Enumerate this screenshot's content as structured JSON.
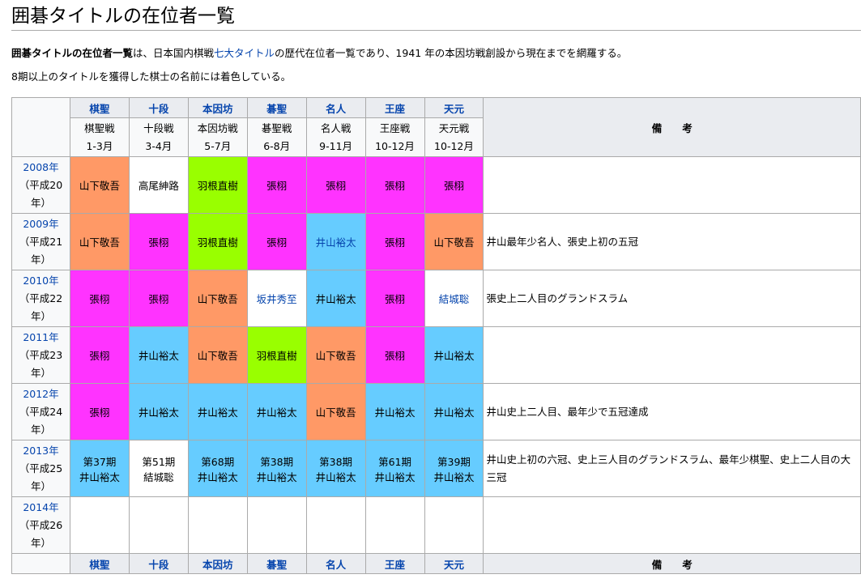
{
  "page": {
    "title": "囲碁タイトルの在位者一覧",
    "intro_bold": "囲碁タイトルの在位者一覧",
    "intro_text1": "は、日本国内棋戦",
    "intro_link": "七大タイトル",
    "intro_text2": "の歴代在位者一覧であり、1941 年の本因坊戦創設から現在までを網羅する。",
    "note": "8期以上のタイトルを獲得した棋士の名前には着色している。"
  },
  "table": {
    "titles": [
      {
        "name": "棋聖",
        "event": "棋聖戦",
        "months": "1-3月"
      },
      {
        "name": "十段",
        "event": "十段戦",
        "months": "3-4月"
      },
      {
        "name": "本因坊",
        "event": "本因坊戦",
        "months": "5-7月"
      },
      {
        "name": "碁聖",
        "event": "碁聖戦",
        "months": "6-8月"
      },
      {
        "name": "名人",
        "event": "名人戦",
        "months": "9-11月"
      },
      {
        "name": "王座",
        "event": "王座戦",
        "months": "10-12月"
      },
      {
        "name": "天元",
        "event": "天元戦",
        "months": "10-12月"
      }
    ],
    "biko_label": "備　　考",
    "colors": {
      "orange": "#ff9966",
      "magenta": "#ff33ff",
      "green": "#99ff00",
      "blue": "#66ccff",
      "link": "#0645ad"
    },
    "rows": [
      {
        "year": "2008年",
        "era": "（平成20年）",
        "cells": [
          {
            "text": "山下敬吾",
            "color": "orange"
          },
          {
            "text": "高尾紳路",
            "color": "white"
          },
          {
            "text": "羽根直樹",
            "color": "green"
          },
          {
            "text": "張栩",
            "color": "magenta"
          },
          {
            "text": "張栩",
            "color": "magenta"
          },
          {
            "text": "張栩",
            "color": "magenta"
          },
          {
            "text": "張栩",
            "color": "magenta"
          }
        ],
        "note": ""
      },
      {
        "year": "2009年",
        "era": "（平成21年）",
        "cells": [
          {
            "text": "山下敬吾",
            "color": "orange"
          },
          {
            "text": "張栩",
            "color": "magenta"
          },
          {
            "text": "羽根直樹",
            "color": "green"
          },
          {
            "text": "張栩",
            "color": "magenta"
          },
          {
            "text": "井山裕太",
            "color": "blue",
            "link": true
          },
          {
            "text": "張栩",
            "color": "magenta"
          },
          {
            "text": "山下敬吾",
            "color": "orange"
          }
        ],
        "note": "井山最年少名人、張史上初の五冠"
      },
      {
        "year": "2010年",
        "era": "（平成22年）",
        "cells": [
          {
            "text": "張栩",
            "color": "magenta"
          },
          {
            "text": "張栩",
            "color": "magenta"
          },
          {
            "text": "山下敬吾",
            "color": "orange"
          },
          {
            "text": "坂井秀至",
            "color": "white",
            "link": true
          },
          {
            "text": "井山裕太",
            "color": "blue"
          },
          {
            "text": "張栩",
            "color": "magenta"
          },
          {
            "text": "結城聡",
            "color": "white",
            "link": true
          }
        ],
        "note": "張史上二人目のグランドスラム"
      },
      {
        "year": "2011年",
        "era": "（平成23年）",
        "cells": [
          {
            "text": "張栩",
            "color": "magenta"
          },
          {
            "text": "井山裕太",
            "color": "blue"
          },
          {
            "text": "山下敬吾",
            "color": "orange"
          },
          {
            "text": "羽根直樹",
            "color": "green"
          },
          {
            "text": "山下敬吾",
            "color": "orange"
          },
          {
            "text": "張栩",
            "color": "magenta"
          },
          {
            "text": "井山裕太",
            "color": "blue"
          }
        ],
        "note": ""
      },
      {
        "year": "2012年",
        "era": "（平成24年）",
        "cells": [
          {
            "text": "張栩",
            "color": "magenta"
          },
          {
            "text": "井山裕太",
            "color": "blue"
          },
          {
            "text": "井山裕太",
            "color": "blue"
          },
          {
            "text": "井山裕太",
            "color": "blue"
          },
          {
            "text": "山下敬吾",
            "color": "orange"
          },
          {
            "text": "井山裕太",
            "color": "blue"
          },
          {
            "text": "井山裕太",
            "color": "blue"
          }
        ],
        "note": "井山史上二人目、最年少で五冠達成"
      },
      {
        "year": "2013年",
        "era": "（平成25年）",
        "cells": [
          {
            "text": "第37期",
            "text2": "井山裕太",
            "color": "blue"
          },
          {
            "text": "第51期",
            "text2": "結城聡",
            "color": "white"
          },
          {
            "text": "第68期",
            "text2": "井山裕太",
            "color": "blue"
          },
          {
            "text": "第38期",
            "text2": "井山裕太",
            "color": "blue"
          },
          {
            "text": "第38期",
            "text2": "井山裕太",
            "color": "blue"
          },
          {
            "text": "第61期",
            "text2": "井山裕太",
            "color": "blue"
          },
          {
            "text": "第39期",
            "text2": "井山裕太",
            "color": "blue"
          }
        ],
        "note": "井山史上初の六冠、史上三人目のグランドスラム、最年少棋聖、史上二人目の大三冠"
      },
      {
        "year": "2014年",
        "era": "（平成26年）",
        "cells": [
          {
            "text": "",
            "color": "white"
          },
          {
            "text": "",
            "color": "white"
          },
          {
            "text": "",
            "color": "white"
          },
          {
            "text": "",
            "color": "white"
          },
          {
            "text": "",
            "color": "white"
          },
          {
            "text": "",
            "color": "white"
          },
          {
            "text": "",
            "color": "white"
          }
        ],
        "note": ""
      }
    ]
  }
}
